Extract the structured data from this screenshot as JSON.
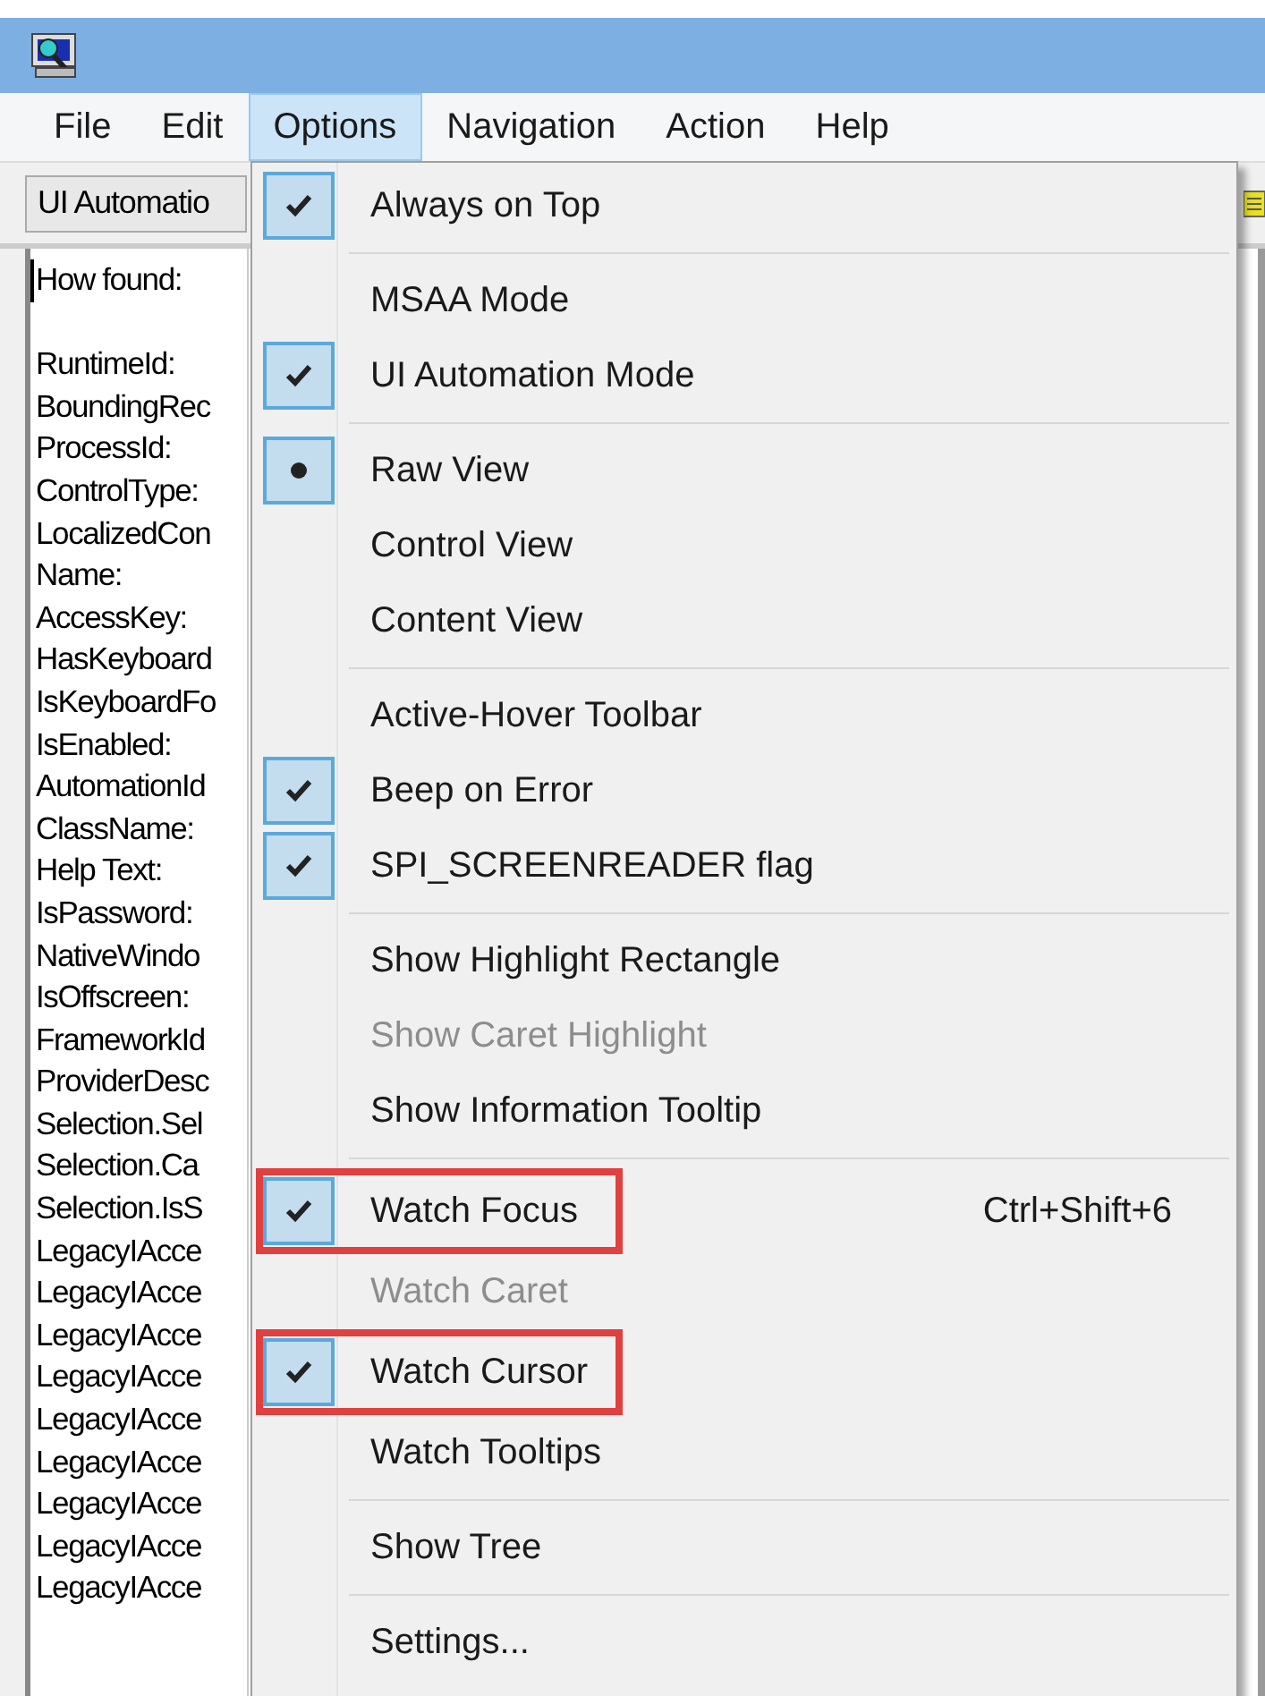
{
  "menu_bar": [
    {
      "label": "File",
      "selected": false
    },
    {
      "label": "Edit",
      "selected": false
    },
    {
      "label": "Options",
      "selected": true
    },
    {
      "label": "Navigation",
      "selected": false
    },
    {
      "label": "Action",
      "selected": false
    },
    {
      "label": "Help",
      "selected": false
    }
  ],
  "toolbar": {
    "selector": "UI Automatio"
  },
  "properties": {
    "header": "How found:",
    "items": [
      "RuntimeId:",
      "BoundingRec",
      "ProcessId:",
      "ControlType:",
      "LocalizedCon",
      "Name:",
      "AccessKey:",
      "HasKeyboard",
      "IsKeyboardFo",
      "IsEnabled:",
      "AutomationId",
      "ClassName:",
      "Help Text:",
      "IsPassword:",
      "NativeWindo",
      "IsOffscreen:",
      "FrameworkId",
      "ProviderDesc",
      "Selection.Sel",
      "Selection.Ca",
      "Selection.IsS",
      "LegacyIAcce",
      "LegacyIAcce",
      "LegacyIAcce",
      "LegacyIAcce",
      "LegacyIAcce",
      "LegacyIAcce",
      "LegacyIAcce",
      "LegacyIAcce",
      "LegacyIAcce"
    ]
  },
  "options_menu": {
    "groups": [
      [
        {
          "label": "Always on Top",
          "kind": "check",
          "checked": true,
          "disabled": false,
          "highlighted": false
        }
      ],
      [
        {
          "label": "MSAA Mode",
          "kind": "check",
          "checked": false,
          "disabled": false,
          "highlighted": false
        },
        {
          "label": "UI Automation Mode",
          "kind": "check",
          "checked": true,
          "disabled": false,
          "highlighted": false
        }
      ],
      [
        {
          "label": "Raw View",
          "kind": "radio",
          "checked": true,
          "disabled": false,
          "highlighted": false
        },
        {
          "label": "Control View",
          "kind": "radio",
          "checked": false,
          "disabled": false,
          "highlighted": false
        },
        {
          "label": "Content View",
          "kind": "radio",
          "checked": false,
          "disabled": false,
          "highlighted": false
        }
      ],
      [
        {
          "label": "Active-Hover Toolbar",
          "kind": "check",
          "checked": false,
          "disabled": false,
          "highlighted": false
        },
        {
          "label": "Beep on Error",
          "kind": "check",
          "checked": true,
          "disabled": false,
          "highlighted": false
        },
        {
          "label": "SPI_SCREENREADER flag",
          "kind": "check",
          "checked": true,
          "disabled": false,
          "highlighted": false
        }
      ],
      [
        {
          "label": "Show Highlight Rectangle",
          "kind": "check",
          "checked": false,
          "disabled": false,
          "highlighted": false
        },
        {
          "label": "Show Caret Highlight",
          "kind": "check",
          "checked": false,
          "disabled": true,
          "highlighted": false
        },
        {
          "label": "Show Information Tooltip",
          "kind": "check",
          "checked": false,
          "disabled": false,
          "highlighted": false
        }
      ],
      [
        {
          "label": "Watch Focus",
          "kind": "check",
          "checked": true,
          "disabled": false,
          "highlighted": true,
          "shortcut": "Ctrl+Shift+6"
        },
        {
          "label": "Watch Caret",
          "kind": "check",
          "checked": false,
          "disabled": true,
          "highlighted": false
        },
        {
          "label": "Watch Cursor",
          "kind": "check",
          "checked": true,
          "disabled": false,
          "highlighted": true
        },
        {
          "label": "Watch Tooltips",
          "kind": "check",
          "checked": false,
          "disabled": false,
          "highlighted": false
        }
      ],
      [
        {
          "label": "Show Tree",
          "kind": "check",
          "checked": false,
          "disabled": false,
          "highlighted": false
        }
      ],
      [
        {
          "label": "Settings...",
          "kind": "check",
          "checked": false,
          "disabled": false,
          "highlighted": false
        }
      ]
    ]
  }
}
